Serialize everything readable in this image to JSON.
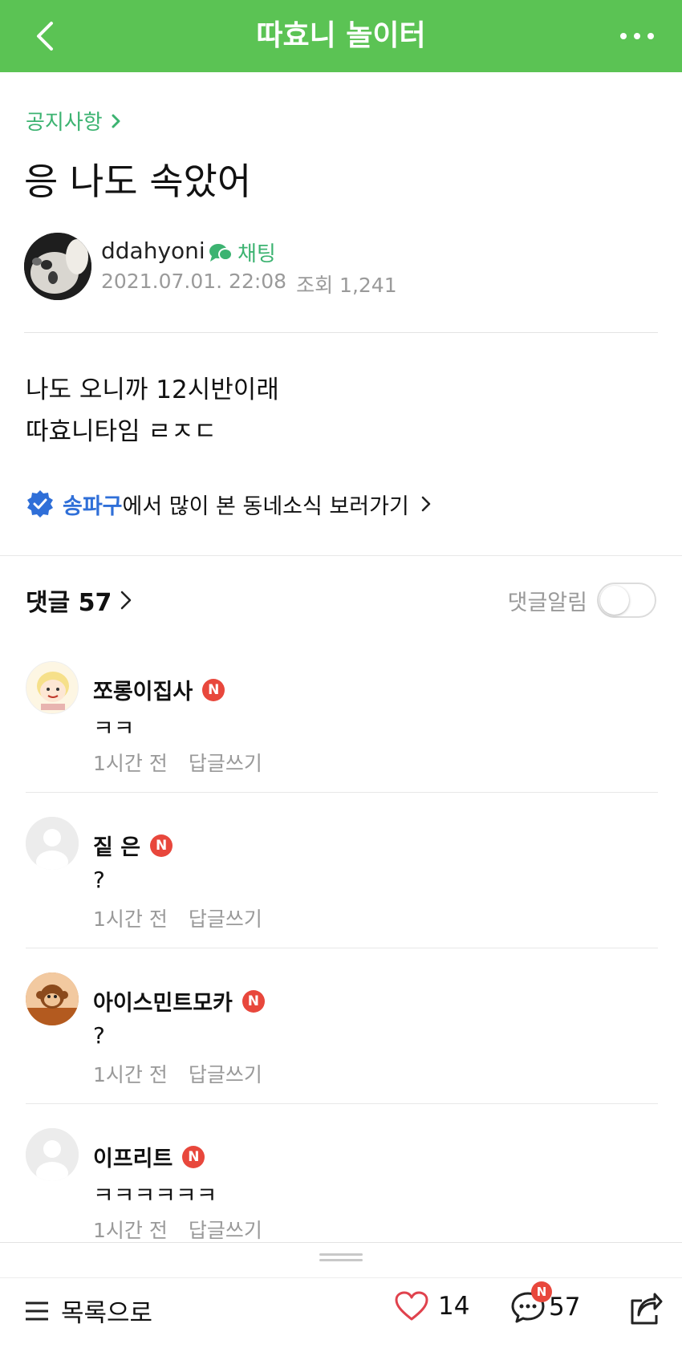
{
  "header": {
    "title": "따효니 놀이터"
  },
  "post": {
    "board": "공지사항",
    "title": "응 나도 속았어",
    "author": "ddahyoni",
    "chat_label": "채팅",
    "date": "2021.07.01. 22:08",
    "views_label": "조회 1,241",
    "body_lines": [
      "나도 오니까 12시반이래",
      "따효니타임 ㄹㅈㄷ"
    ],
    "local": {
      "region": "송파구",
      "text": "에서 많이 본 동네소식 보러가기"
    }
  },
  "comments_header": {
    "label": "댓글 57",
    "alarm_label": "댓글알림"
  },
  "comments": [
    {
      "name": "쪼롱이집사",
      "badge": "N",
      "text": "ㅋㅋ",
      "time": "1시간 전",
      "reply": "답글쓰기"
    },
    {
      "name": "짙 은",
      "badge": "N",
      "text": "?",
      "time": "1시간 전",
      "reply": "답글쓰기"
    },
    {
      "name": "아이스민트모카",
      "badge": "N",
      "text": "?",
      "time": "1시간 전",
      "reply": "답글쓰기"
    },
    {
      "name": "이프리트",
      "badge": "N",
      "text": "ㅋㅋㅋㅋㅋㅋ",
      "time": "1시간 전",
      "reply": "답글쓰기"
    }
  ],
  "bottom_bar": {
    "list_label": "목록으로",
    "likes": "14",
    "comments_count": "57",
    "comment_badge": "N"
  },
  "colors": {
    "brand_green": "#5bc354",
    "link_green": "#3cb371",
    "region_blue": "#2f6fd8",
    "badge_red": "#e8473c"
  }
}
